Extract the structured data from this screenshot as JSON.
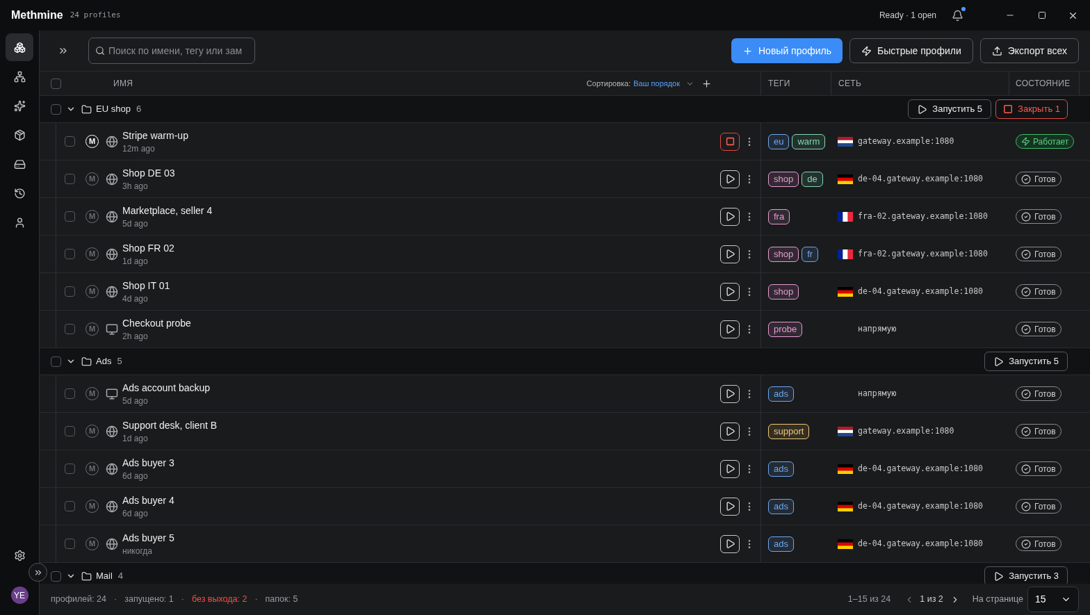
{
  "app": {
    "name": "Methmine",
    "subtitle": "24 profiles",
    "status": "Ready · 1 open",
    "notification": true
  },
  "sidebar": {
    "items": [
      {
        "kind": "profiles",
        "selected": true
      },
      {
        "kind": "network",
        "selected": false
      },
      {
        "kind": "sparkles",
        "selected": false
      },
      {
        "kind": "package",
        "selected": false
      },
      {
        "kind": "drive",
        "selected": false
      },
      {
        "kind": "history",
        "selected": false
      },
      {
        "kind": "user",
        "selected": false
      }
    ],
    "avatar": "YE"
  },
  "toolbar": {
    "search": {
      "placeholder": "Поиск по имени, тегу или зам"
    },
    "buttons": [
      {
        "kind": "primary",
        "label": "Новый профиль"
      },
      {
        "kind": "quick",
        "label": "Быстрые профили"
      },
      {
        "kind": "export",
        "label": "Экспорт всех"
      }
    ]
  },
  "table": {
    "select_all": {
      "checked": false
    },
    "columns": {
      "name": "ИМЯ",
      "sort_label": "Сортировка:",
      "sort_value": "Ваш порядок",
      "tags": "ТЕГИ",
      "network": "СЕТЬ",
      "status": "СОСТОЯНИЕ"
    },
    "groups": [
      {
        "name": "EU shop",
        "count": "6",
        "expanded": true,
        "checked": false,
        "actions": [
          {
            "kind": "start",
            "label": "Запустить 5"
          },
          {
            "kind": "stop",
            "label": "Закрыть 1"
          }
        ],
        "profiles": [
          {
            "name": "Stripe warm-up",
            "last_seen": "12m ago",
            "engine": "M",
            "kind": "globe",
            "checked": false,
            "tags": [
              {
                "label": "eu",
                "color": "#6aa8f0"
              },
              {
                "label": "warm",
                "color": "#7fd8b0"
              }
            ],
            "network": {
              "kind": "nl",
              "address": "gateway.example:1080"
            },
            "status": {
              "kind": "running",
              "label": "Работает"
            }
          },
          {
            "name": "Shop DE 03",
            "last_seen": "3h ago",
            "engine": "M",
            "kind": "globe",
            "checked": false,
            "tags": [
              {
                "label": "shop",
                "color": "#e89ad2"
              },
              {
                "label": "de",
                "color": "#7fd8b0"
              }
            ],
            "network": {
              "kind": "de",
              "address": "de-04.gateway.example:1080"
            },
            "status": {
              "kind": "ready",
              "label": "Готов"
            }
          },
          {
            "name": "Marketplace, seller 4",
            "last_seen": "5d ago",
            "engine": "M",
            "kind": "globe",
            "checked": false,
            "tags": [
              {
                "label": "fra",
                "color": "#e89ad2"
              }
            ],
            "network": {
              "kind": "fr",
              "address": "fra-02.gateway.example:1080"
            },
            "status": {
              "kind": "ready",
              "label": "Готов"
            }
          },
          {
            "name": "Shop FR 02",
            "last_seen": "1d ago",
            "engine": "M",
            "kind": "globe",
            "checked": false,
            "tags": [
              {
                "label": "shop",
                "color": "#e89ad2"
              },
              {
                "label": "fr",
                "color": "#6aa8f0"
              }
            ],
            "network": {
              "kind": "fr",
              "address": "fra-02.gateway.example:1080"
            },
            "status": {
              "kind": "ready",
              "label": "Готов"
            }
          },
          {
            "name": "Shop IT 01",
            "last_seen": "4d ago",
            "engine": "M",
            "kind": "globe",
            "checked": false,
            "tags": [
              {
                "label": "shop",
                "color": "#e89ad2"
              }
            ],
            "network": {
              "kind": "de",
              "address": "de-04.gateway.example:1080"
            },
            "status": {
              "kind": "ready",
              "label": "Готов"
            }
          },
          {
            "name": "Checkout probe",
            "last_seen": "2h ago",
            "engine": "M",
            "kind": "monitor",
            "checked": false,
            "tags": [
              {
                "label": "probe",
                "color": "#e89ad2"
              }
            ],
            "network": {
              "kind": "direct",
              "address": "напрямую"
            },
            "status": {
              "kind": "ready",
              "label": "Готов"
            }
          }
        ]
      },
      {
        "name": "Ads",
        "count": "5",
        "expanded": true,
        "checked": false,
        "actions": [
          {
            "kind": "start",
            "label": "Запустить 5"
          }
        ],
        "profiles": [
          {
            "name": "Ads account backup",
            "last_seen": "5d ago",
            "engine": "M",
            "kind": "monitor",
            "checked": false,
            "tags": [
              {
                "label": "ads",
                "color": "#6aa8f0"
              }
            ],
            "network": {
              "kind": "direct",
              "address": "напрямую"
            },
            "status": {
              "kind": "ready",
              "label": "Готов"
            }
          },
          {
            "name": "Support desk, client B",
            "last_seen": "1d ago",
            "engine": "M",
            "kind": "globe",
            "checked": false,
            "tags": [
              {
                "label": "support",
                "color": "#f0c870"
              }
            ],
            "network": {
              "kind": "nl",
              "address": "gateway.example:1080"
            },
            "status": {
              "kind": "ready",
              "label": "Готов"
            }
          },
          {
            "name": "Ads buyer 3",
            "last_seen": "6d ago",
            "engine": "M",
            "kind": "globe",
            "checked": false,
            "tags": [
              {
                "label": "ads",
                "color": "#6aa8f0"
              }
            ],
            "network": {
              "kind": "de",
              "address": "de-04.gateway.example:1080"
            },
            "status": {
              "kind": "ready",
              "label": "Готов"
            }
          },
          {
            "name": "Ads buyer 4",
            "last_seen": "6d ago",
            "engine": "M",
            "kind": "globe",
            "checked": false,
            "tags": [
              {
                "label": "ads",
                "color": "#6aa8f0"
              }
            ],
            "network": {
              "kind": "de",
              "address": "de-04.gateway.example:1080"
            },
            "status": {
              "kind": "ready",
              "label": "Готов"
            }
          },
          {
            "name": "Ads buyer 5",
            "last_seen": "никогда",
            "engine": "M",
            "kind": "globe",
            "checked": false,
            "tags": [
              {
                "label": "ads",
                "color": "#6aa8f0"
              }
            ],
            "network": {
              "kind": "de",
              "address": "de-04.gateway.example:1080"
            },
            "status": {
              "kind": "ready",
              "label": "Готов"
            }
          }
        ]
      },
      {
        "name": "Mail",
        "count": "4",
        "expanded": true,
        "checked": false,
        "actions": [
          {
            "kind": "start",
            "label": "Запустить 3"
          }
        ]
      }
    ]
  },
  "footer": {
    "separator": "·",
    "stats": [
      {
        "label": "профилей: 24",
        "alert": false
      },
      {
        "label": "запущено: 1",
        "alert": false
      },
      {
        "label": "без выхода: 2",
        "alert": true
      },
      {
        "label": "папок: 5",
        "alert": false
      }
    ],
    "range": "1–15 из 24",
    "page": "1 из 2",
    "per_page_label": "На странице",
    "per_page": "15"
  }
}
